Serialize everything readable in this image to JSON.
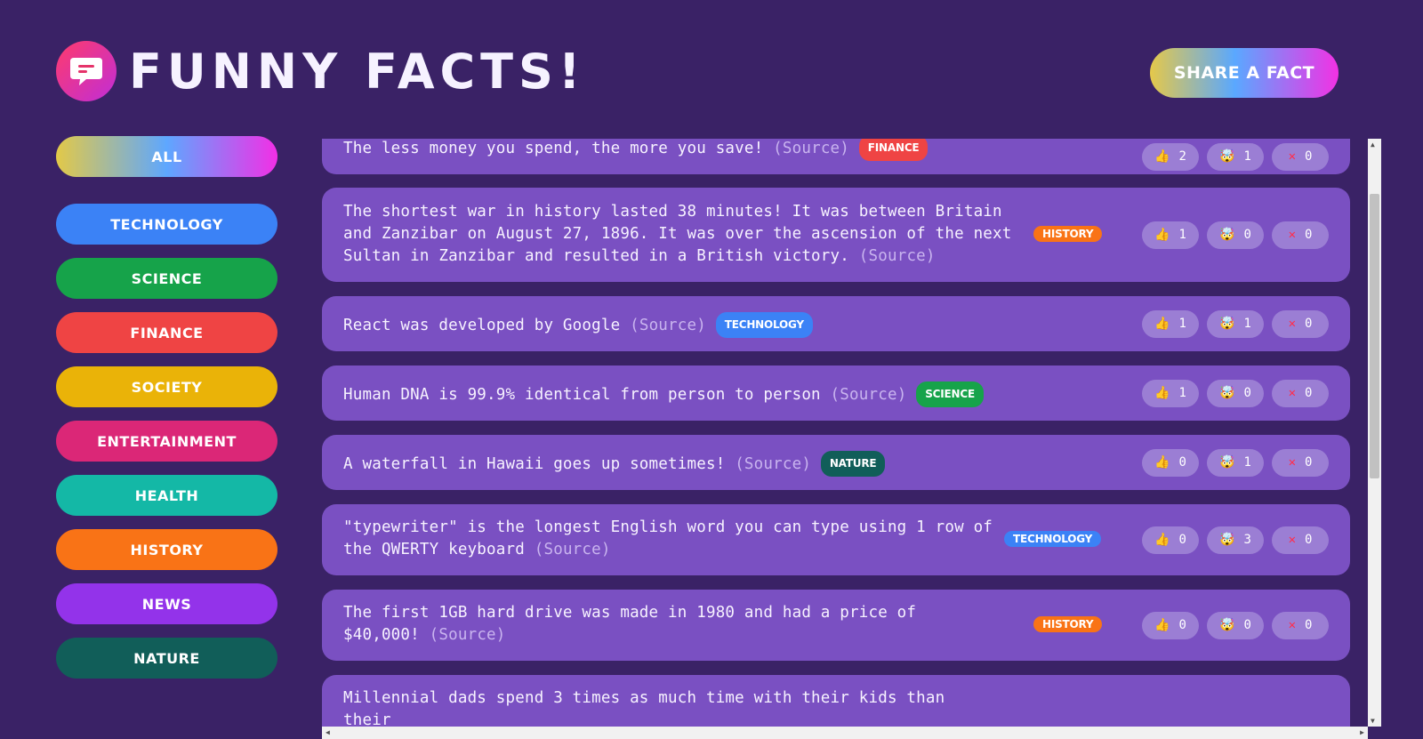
{
  "header": {
    "title": "FUNNY FACTS!",
    "share_label": "SHARE A FACT"
  },
  "sidebar": {
    "all_label": "ALL",
    "categories": [
      {
        "label": "TECHNOLOGY",
        "color": "#3b82f6"
      },
      {
        "label": "SCIENCE",
        "color": "#16a34a"
      },
      {
        "label": "FINANCE",
        "color": "#ef4444"
      },
      {
        "label": "SOCIETY",
        "color": "#eab308"
      },
      {
        "label": "ENTERTAINMENT",
        "color": "#db2777"
      },
      {
        "label": "HEALTH",
        "color": "#14b8a6"
      },
      {
        "label": "HISTORY",
        "color": "#f97316"
      },
      {
        "label": "NEWS",
        "color": "#9333ea"
      },
      {
        "label": "NATURE",
        "color": "#115e59"
      }
    ]
  },
  "facts": [
    {
      "text": "The less money you spend, the more you save!",
      "source": "(Source)",
      "category": "FINANCE",
      "category_color": "#ef4444",
      "interesting": "2",
      "mindblowing": "1",
      "false": "0"
    },
    {
      "text": "The shortest war in history lasted 38 minutes! It was between Britain and Zanzibar on August 27, 1896. It was over the ascension of the next Sultan in Zanzibar and resulted in a British victory.",
      "source": "(Source)",
      "category": "HISTORY",
      "category_color": "#f97316",
      "interesting": "1",
      "mindblowing": "0",
      "false": "0"
    },
    {
      "text": "React was developed by Google",
      "source": "(Source)",
      "category": "TECHNOLOGY",
      "category_color": "#3b82f6",
      "interesting": "1",
      "mindblowing": "1",
      "false": "0"
    },
    {
      "text": "Human DNA is 99.9% identical from person to person",
      "source": "(Source)",
      "category": "SCIENCE",
      "category_color": "#16a34a",
      "interesting": "1",
      "mindblowing": "0",
      "false": "0"
    },
    {
      "text": "A waterfall in Hawaii goes up sometimes!",
      "source": "(Source)",
      "category": "NATURE",
      "category_color": "#115e59",
      "interesting": "0",
      "mindblowing": "1",
      "false": "0"
    },
    {
      "text": "\"typewriter\" is the longest English word you can type using 1 row of the QWERTY keyboard",
      "source": "(Source)",
      "category": "TECHNOLOGY",
      "category_color": "#3b82f6",
      "interesting": "0",
      "mindblowing": "3",
      "false": "0"
    },
    {
      "text": "The first 1GB hard drive was made in 1980 and had a price of $40,000!",
      "source": "(Source)",
      "category": "HISTORY",
      "category_color": "#f97316",
      "interesting": "0",
      "mindblowing": "0",
      "false": "0"
    },
    {
      "text": "Millennial dads spend 3 times as much time with their kids than their"
    }
  ],
  "icons": {
    "logo": "chat-bubble-icon",
    "interesting": "thumbs-up-icon",
    "mindblowing": "mind-blown-icon",
    "false": "x-icon"
  }
}
